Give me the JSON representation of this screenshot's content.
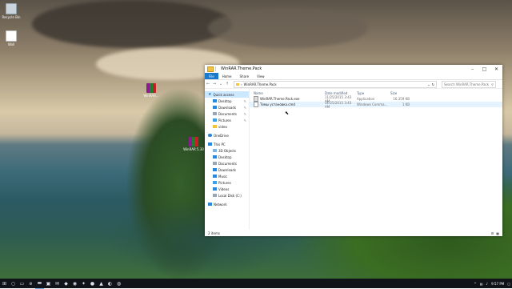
{
  "desktop": {
    "icons": [
      {
        "label": "Recycle Bin"
      },
      {
        "label": "Wall"
      },
      {
        "label": "WinRAR..."
      },
      {
        "label": "WinRAR 5.30"
      }
    ]
  },
  "window": {
    "title": "WinRAR.Theme.Pack",
    "controls": {
      "minimize": "–",
      "maximize": "□",
      "close": "✕"
    },
    "ribbon_tabs": [
      "File",
      "Home",
      "Share",
      "View"
    ],
    "address_path": "WinRAR.Theme.Pack",
    "search_placeholder": "Search WinRAR.Theme.Pack",
    "nav": {
      "quick_access": "Quick access",
      "items": [
        {
          "label": "Desktop",
          "pinned": true
        },
        {
          "label": "Downloads",
          "pinned": true
        },
        {
          "label": "Documents",
          "pinned": true
        },
        {
          "label": "Pictures",
          "pinned": true
        },
        {
          "label": "video",
          "pinned": false
        }
      ],
      "onedrive": "OneDrive",
      "this_pc": "This PC",
      "pc_items": [
        "3D Objects",
        "Desktop",
        "Documents",
        "Downloads",
        "Music",
        "Pictures",
        "Videos",
        "Local Disk (C:)"
      ],
      "network": "Network"
    },
    "columns": {
      "name": "Name",
      "date": "Date modified",
      "type": "Type",
      "size": "Size"
    },
    "files": [
      {
        "name": "WinRAR.Theme.Pack.exe",
        "date": "11/25/2015 3:43 AM",
        "type": "Application",
        "size": "16,359 KB"
      },
      {
        "name": "Темы установка.cmd",
        "date": "11/25/2015 3:43 AM",
        "type": "Windows Comma...",
        "size": "1 KB"
      }
    ],
    "status": "2 items"
  },
  "taskbar": {
    "time": "9:57 PM",
    "date": ""
  }
}
